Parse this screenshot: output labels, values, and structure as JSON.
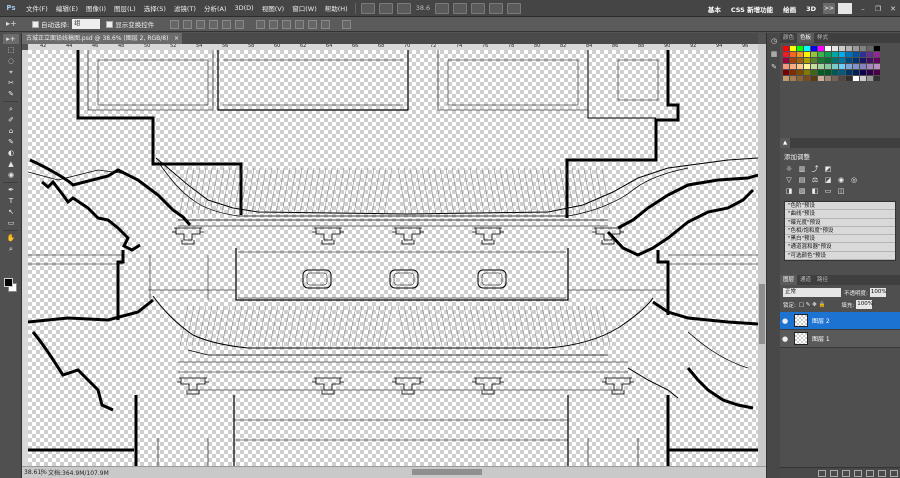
{
  "menubar": {
    "logo": "Ps",
    "items": [
      "文件(F)",
      "编辑(E)",
      "图像(I)",
      "图层(L)",
      "选择(S)",
      "滤镜(T)",
      "分析(A)",
      "3D(D)",
      "视图(V)",
      "窗口(W)",
      "帮助(H)"
    ],
    "zoom": "38.6",
    "workspaces": [
      "基本",
      "CSS 新增功能",
      "绘画",
      "3D"
    ],
    "expand": ">>"
  },
  "optionsbar": {
    "tool_icon": "▸+",
    "auto_select_label": "自动选择:",
    "auto_select_value": "组",
    "show_transform_label": "显示变换控件"
  },
  "document": {
    "tab_title": "古城正立面铅线稿图.psd @ 38.6% (图层 2, RGB/8)",
    "ruler_labels": [
      "42",
      "44",
      "46",
      "48",
      "50",
      "52",
      "54",
      "56",
      "58",
      "60",
      "62",
      "64",
      "66",
      "68",
      "70",
      "72",
      "74",
      "76",
      "78",
      "80",
      "82",
      "84",
      "86",
      "88",
      "90",
      "92",
      "94",
      "96"
    ],
    "zoom_status": "38.61%",
    "doc_status": "文档:364.9M/107.9M"
  },
  "tools": [
    "▸+",
    "⬚",
    "◌",
    "⌖",
    "✂",
    "✎",
    "⌕",
    "✐",
    "⌂",
    "✎",
    "◐",
    "▲",
    "◉",
    "✒",
    "T",
    "↖",
    "▭",
    "✋",
    "⌕"
  ],
  "panels": {
    "color_tabs": [
      "颜色",
      "色板",
      "样式"
    ],
    "swatch_colors": [
      "#ff0000",
      "#ffff00",
      "#00ff00",
      "#00ffff",
      "#0000ff",
      "#ff00ff",
      "#ffffff",
      "#e6e6e6",
      "#cccccc",
      "#b3b3b3",
      "#999999",
      "#808080",
      "#666666",
      "#000000",
      "#ed1c24",
      "#f26522",
      "#f7941d",
      "#fff200",
      "#8dc63f",
      "#39b54a",
      "#00a651",
      "#00a99d",
      "#00aeef",
      "#0072bc",
      "#0054a6",
      "#2e3192",
      "#662d91",
      "#92278f",
      "#9e0039",
      "#a0410d",
      "#a3620a",
      "#aba000",
      "#598527",
      "#1a7b30",
      "#007236",
      "#00746b",
      "#0076a3",
      "#004a80",
      "#003471",
      "#1b1464",
      "#440e62",
      "#630460",
      "#f7977a",
      "#f9ad81",
      "#fdc68a",
      "#fff79a",
      "#c4df9b",
      "#a3d39c",
      "#82ca9d",
      "#7accc8",
      "#6dcff6",
      "#7da7d9",
      "#8393ca",
      "#8781bd",
      "#a187be",
      "#bc8dbf",
      "#790000",
      "#7b2e00",
      "#7d4900",
      "#827b00",
      "#406618",
      "#005e20",
      "#005826",
      "#005952",
      "#005b7f",
      "#003663",
      "#002157",
      "#0d004c",
      "#32004b",
      "#4b0049",
      "#c69c6d",
      "#a67c52",
      "#8c6239",
      "#754c24",
      "#603913",
      "#c7b299",
      "#998675",
      "#736357",
      "#534741",
      "#362f2d",
      "#ffffff",
      "#cccccc",
      "#999999",
      "#333333"
    ],
    "adjust_title": "添加调整",
    "presets": [
      "\"色阶\"预设",
      "\"曲线\"预设",
      "\"曝光度\"预设",
      "\"色相/饱和度\"预设",
      "\"黑白\"预设",
      "\"通道混和器\"预设",
      "\"可选颜色\"预设"
    ],
    "layers_tabs": [
      "图层",
      "通道",
      "路径"
    ],
    "blend_mode": "正常",
    "opacity_label": "不透明度:",
    "opacity_value": "100%",
    "lock_label": "锁定:",
    "fill_label": "填充:",
    "fill_value": "100%",
    "layers": [
      {
        "name": "图层 2",
        "selected": true
      },
      {
        "name": "图层 1",
        "selected": false
      }
    ]
  }
}
